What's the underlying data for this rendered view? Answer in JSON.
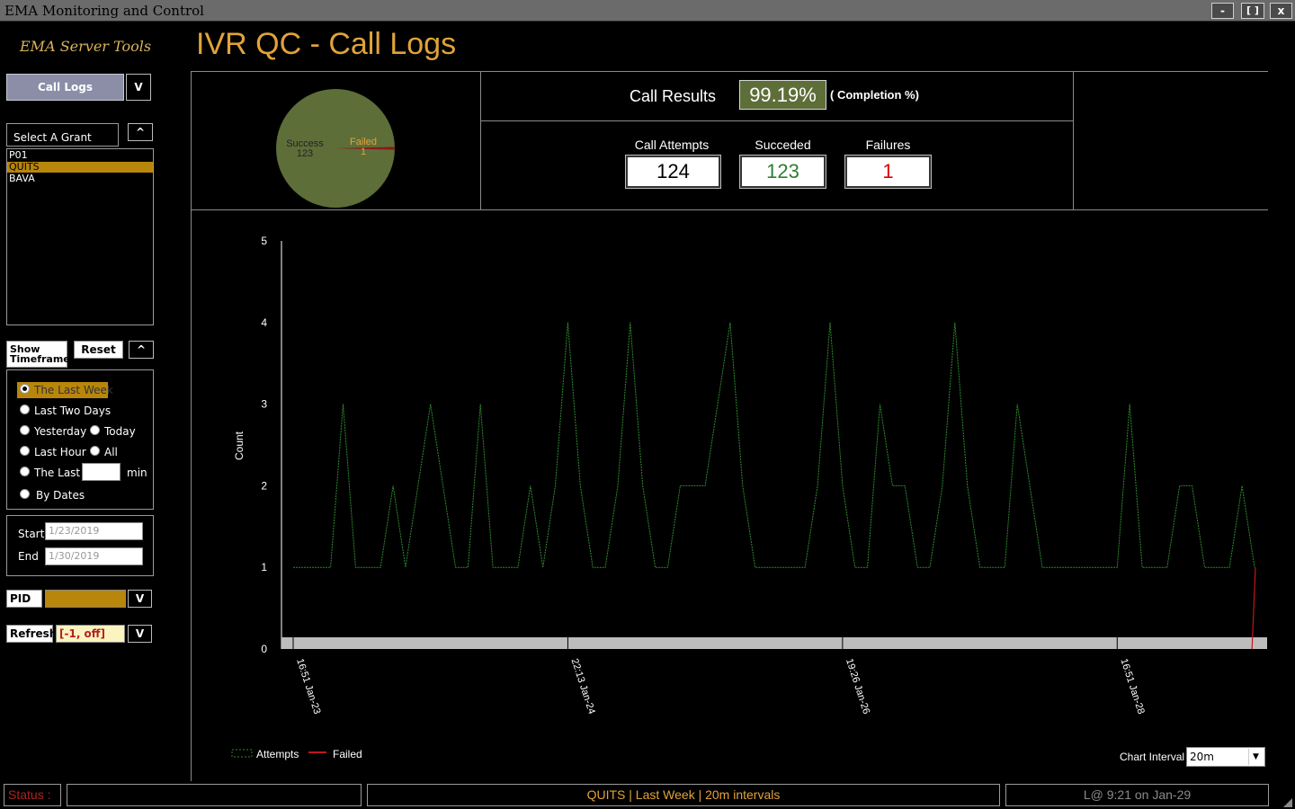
{
  "window": {
    "title": "EMA Monitoring and Control",
    "min": "-",
    "max": "[ ]",
    "close": "x"
  },
  "sidebar": {
    "brand": "EMA Server Tools",
    "view_button": "Call Logs",
    "view_toggle": "V",
    "grant_label": "Select A Grant",
    "grant_toggle": "^",
    "grants": [
      "P01",
      "QUITS",
      "BAVA"
    ],
    "selected_grant": "QUITS",
    "timeframe_label": "Show Timeframe",
    "reset": "Reset",
    "timeframe_toggle": "^",
    "options": {
      "last_week": "The Last Week",
      "last_two_days": "Last Two Days",
      "yesterday": "Yesterday",
      "today": "Today",
      "last_hour": "Last Hour",
      "all": "All",
      "the_last": "The Last",
      "min": "min",
      "by_dates": "By Dates"
    },
    "selected_option": "The Last Week",
    "start_label": "Start",
    "start_value": "1/23/2019",
    "end_label": "End",
    "end_value": "1/30/2019",
    "pid_label": "PID",
    "pid_toggle": "V",
    "refresh_label": "Refresh",
    "refresh_value": "[-1, off]",
    "refresh_toggle": "V"
  },
  "header": {
    "title": "IVR QC - Call Logs"
  },
  "pie": {
    "success_label": "Success",
    "success_value": "123",
    "failed_label": "Failed",
    "failed_value": "1"
  },
  "results": {
    "label": "Call Results",
    "completion": "99.19%",
    "completion_suffix": "( Completion %)",
    "attempts_label": "Call Attempts",
    "attempts": "124",
    "succeeded_label": "Succeded",
    "succeeded": "123",
    "failures_label": "Failures",
    "failures": "1"
  },
  "colors": {
    "accent": "#e0a33a",
    "pie": "#5e6e38",
    "attempts_line": "#2e8b2e",
    "failed_line": "#c0171b",
    "highlight": "#b8860b"
  },
  "chart_data": {
    "type": "line",
    "ylabel": "Count",
    "ylim": [
      0,
      5
    ],
    "yticks": [
      "0",
      "1",
      "2",
      "3",
      "4",
      "5"
    ],
    "xticks": [
      "16:51 Jan-23",
      "22:13 Jan-24",
      "19:26 Jan-26",
      "16:51 Jan-28"
    ],
    "series": [
      {
        "name": "Attempts",
        "values": [
          1,
          1,
          1,
          1,
          3,
          1,
          1,
          1,
          2,
          1,
          2,
          3,
          2,
          1,
          1,
          3,
          1,
          1,
          1,
          2,
          1,
          2,
          4,
          2,
          1,
          1,
          2,
          4,
          2,
          1,
          1,
          2,
          2,
          2,
          3,
          4,
          2,
          1,
          1,
          1,
          1,
          1,
          2,
          4,
          2,
          1,
          1,
          3,
          2,
          2,
          1,
          1,
          2,
          4,
          2,
          1,
          1,
          1,
          3,
          2,
          1,
          1,
          1,
          1,
          1,
          1,
          1,
          3,
          1,
          1,
          1,
          2,
          2,
          1,
          1,
          1,
          2,
          1
        ]
      },
      {
        "name": "Failed",
        "values": [
          0,
          0,
          0,
          0,
          0,
          0,
          0,
          0,
          0,
          0,
          0,
          0,
          0,
          0,
          0,
          0,
          0,
          0,
          0,
          0,
          0,
          0,
          0,
          0,
          0,
          0,
          0,
          0,
          0,
          0,
          0,
          0,
          0,
          0,
          0,
          0,
          0,
          0,
          0,
          0,
          0,
          0,
          0,
          0,
          0,
          0,
          0,
          0,
          0,
          0,
          0,
          0,
          0,
          0,
          0,
          0,
          0,
          0,
          0,
          0,
          0,
          0,
          0,
          0,
          0,
          0,
          0,
          0,
          0,
          0,
          0,
          0,
          0,
          0,
          0,
          0,
          0,
          1
        ]
      }
    ],
    "legend": "bottom-left",
    "interval_label": "Chart Interval",
    "interval_value": "20m"
  },
  "status": {
    "label": "Status :",
    "message": "",
    "summary": "QUITS  |  Last Week  |  20m intervals",
    "login": "L@ 9:21 on Jan-29"
  }
}
